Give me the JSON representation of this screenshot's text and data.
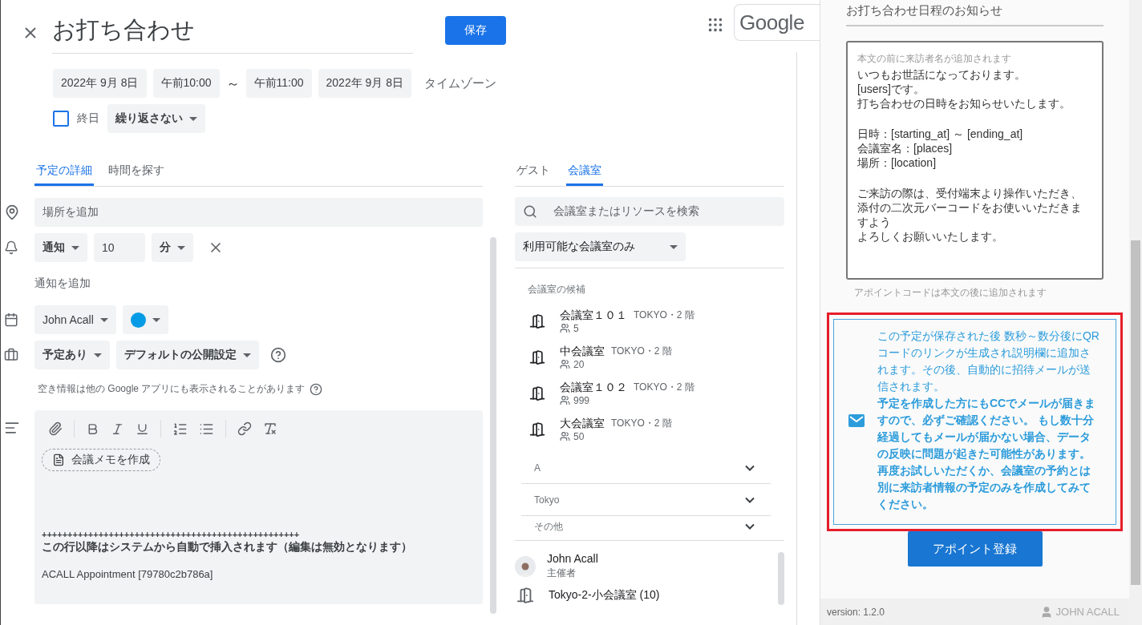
{
  "header": {
    "title": "お打ち合わせ",
    "save_button": "保存",
    "logo": "Google"
  },
  "dates": {
    "start_date": "2022年 9月 8日",
    "start_time": "午前10:00",
    "separator": "～",
    "end_time": "午前11:00",
    "end_date": "2022年 9月 8日",
    "timezone": "タイムゾーン"
  },
  "all_day": {
    "label": "終日",
    "checked": false
  },
  "repeat": "繰り返さない",
  "detail_tabs": [
    {
      "label": "予定の詳細",
      "selected": true
    },
    {
      "label": "時間を探す",
      "selected": false
    }
  ],
  "location": {
    "placeholder": "場所を追加"
  },
  "notification": {
    "type": "通知",
    "value": "10",
    "unit": "分"
  },
  "add_notification": "通知を追加",
  "calendar": {
    "owner": "John Acall",
    "color": "#039be5"
  },
  "availability": {
    "status": "予定あり",
    "visibility": "デフォルトの公開設定"
  },
  "availability_note": "空き情報は他の Google アプリにも表示されることがあります",
  "description": {
    "notes_button": "会議メモを作成",
    "separator": "++++++++++++++++++++++++++++++++++++++++++++++++++",
    "system_notice": "この行以降はシステムから自動で挿入されます（編集は無効となります）",
    "appointment": "ACALL Appointment [79780c2b786a]"
  },
  "guest_tabs": [
    {
      "label": "ゲスト",
      "selected": false
    },
    {
      "label": "会議室",
      "selected": true
    }
  ],
  "room_search": {
    "placeholder": "会議室またはリソースを検索"
  },
  "room_filter": "利用可能な会議室のみ",
  "room_section": "会議室の候補",
  "rooms": [
    {
      "name": "会議室１０１",
      "location": "TOKYO・2 階",
      "capacity": "5"
    },
    {
      "name": "中会議室",
      "location": "TOKYO・2 階",
      "capacity": "20"
    },
    {
      "name": "会議室１０２",
      "location": "TOKYO・2 階",
      "capacity": "999"
    },
    {
      "name": "大会議室",
      "location": "TOKYO・2 階",
      "capacity": "50"
    }
  ],
  "room_groups": [
    {
      "label": "A",
      "expanded": false
    },
    {
      "label": "Tokyo",
      "expanded": false
    },
    {
      "label": "その他",
      "expanded": false
    }
  ],
  "attendees": [
    {
      "kind": "person",
      "name": "John Acall",
      "role": "主催者"
    },
    {
      "kind": "room",
      "name": "Tokyo-2-小会議室 (10)"
    }
  ],
  "panel": {
    "subject": "お打ち合わせ日程のお知らせ",
    "body_hint": "本文の前に来訪者名が追加されます",
    "body": [
      [
        "いつもお世話になっております。",
        "[users]です。",
        "打ち合わせの日時をお知らせいたします。"
      ],
      [
        "日時：[starting_at] ～ [ending_at]",
        "会議室名：[places]",
        "場所：[location]"
      ],
      [
        "ご来訪の際は、受付端末より操作いただき、",
        "添付の二次元バーコードをお使いいただきますよう",
        "よろしくお願いいたします。"
      ]
    ],
    "footer_hint": "アポイントコードは本文の後に追加されます",
    "notice": "この予定が保存された後 数秒～数分後にQRコードのリンクが生成され説明欄に追加されます。その後、自動的に招待メールが送信されます。",
    "warning": "予定を作成した方にもCCでメールが届きますので、必ずご確認ください。 もし数十分経過してもメールが届かない場合、データの反映に問題が起きた可能性があります。再度お試しいただくか、会議室の予約とは別に来訪者情報の予定のみを作成してみてください。",
    "submit": "アポイント登録",
    "version": "version: 1.2.0",
    "user": "JOHN ACALL"
  }
}
